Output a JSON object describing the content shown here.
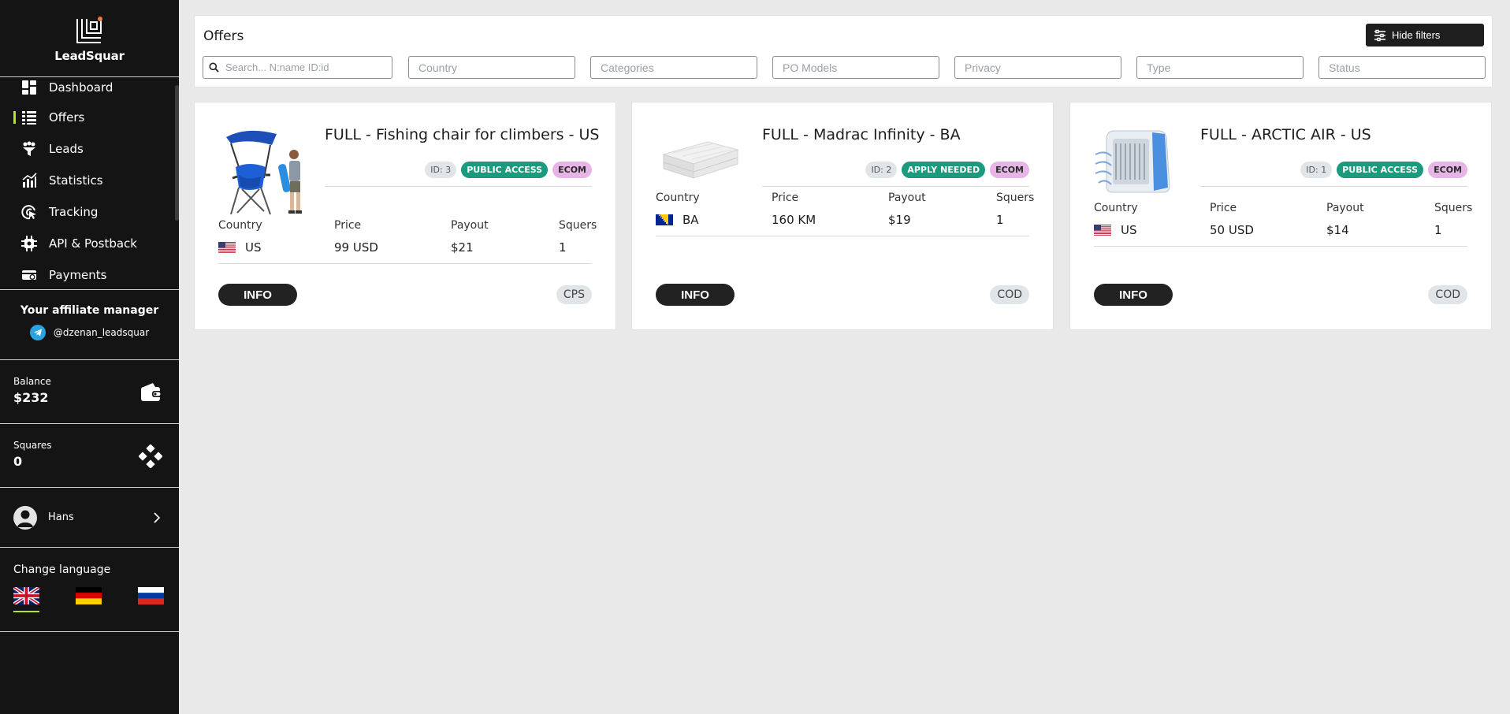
{
  "sidebar": {
    "brand": "LeadSquar",
    "nav": [
      {
        "label": "Dashboard",
        "icon": "dashboard-icon"
      },
      {
        "label": "Offers",
        "icon": "list-icon",
        "active": true
      },
      {
        "label": "Leads",
        "icon": "leads-icon"
      },
      {
        "label": "Statistics",
        "icon": "statistics-icon"
      },
      {
        "label": "Tracking",
        "icon": "tracking-icon"
      },
      {
        "label": "API & Postback",
        "icon": "api-icon"
      },
      {
        "label": "Payments",
        "icon": "payments-icon"
      }
    ],
    "manager": {
      "title": "Your affiliate manager",
      "contact": "@dzenan_leadsquar",
      "icon": "telegram-icon"
    },
    "balance": {
      "label": "Balance",
      "value": "$232",
      "icon": "wallet-icon"
    },
    "squares": {
      "label": "Squares",
      "value": "0",
      "icon": "squares-icon"
    },
    "user": {
      "name": "Hans"
    },
    "language": {
      "title": "Change language",
      "options": [
        "uk-flag",
        "germany-flag",
        "russia-flag"
      ],
      "active": "uk-flag"
    }
  },
  "filters": {
    "title": "Offers",
    "hide_label": "Hide filters",
    "search_placeholder": "Search... N:name ID:id",
    "country_placeholder": "Country",
    "categories_placeholder": "Categories",
    "po_models_placeholder": "PO Models",
    "privacy_placeholder": "Privacy",
    "type_placeholder": "Type",
    "status_placeholder": "Status"
  },
  "offers": [
    {
      "title": "FULL - Fishing chair for climbers - US",
      "id_badge": "ID: 3",
      "access": "PUBLIC ACCESS",
      "vertical": "ECOM",
      "labels": {
        "country": "Country",
        "price": "Price",
        "payout": "Payout",
        "squers": "Squers"
      },
      "country": "US",
      "price": "99 USD",
      "payout": "$21",
      "squers": "1",
      "info": "INFO",
      "model": "CPS",
      "image": "fishing-chair-image"
    },
    {
      "title": "FULL - Madrac Infinity - BA",
      "id_badge": "ID: 2",
      "access": "APPLY NEEDED",
      "vertical": "ECOM",
      "labels": {
        "country": "Country",
        "price": "Price",
        "payout": "Payout",
        "squers": "Squers"
      },
      "country": "BA",
      "price": "160 KM",
      "payout": "$19",
      "squers": "1",
      "info": "INFO",
      "model": "COD",
      "image": "mattress-image"
    },
    {
      "title": "FULL - ARCTIC AIR - US",
      "id_badge": "ID: 1",
      "access": "PUBLIC ACCESS",
      "vertical": "ECOM",
      "labels": {
        "country": "Country",
        "price": "Price",
        "payout": "Payout",
        "squers": "Squers"
      },
      "country": "US",
      "price": "50 USD",
      "payout": "$14",
      "squers": "1",
      "info": "INFO",
      "model": "COD",
      "image": "air-cooler-image"
    }
  ],
  "colors": {
    "sidebar_bg": "#141414",
    "accent": "#b4e61c",
    "public_access": "#1b9a7e",
    "ecom": "#e7b4e6"
  }
}
